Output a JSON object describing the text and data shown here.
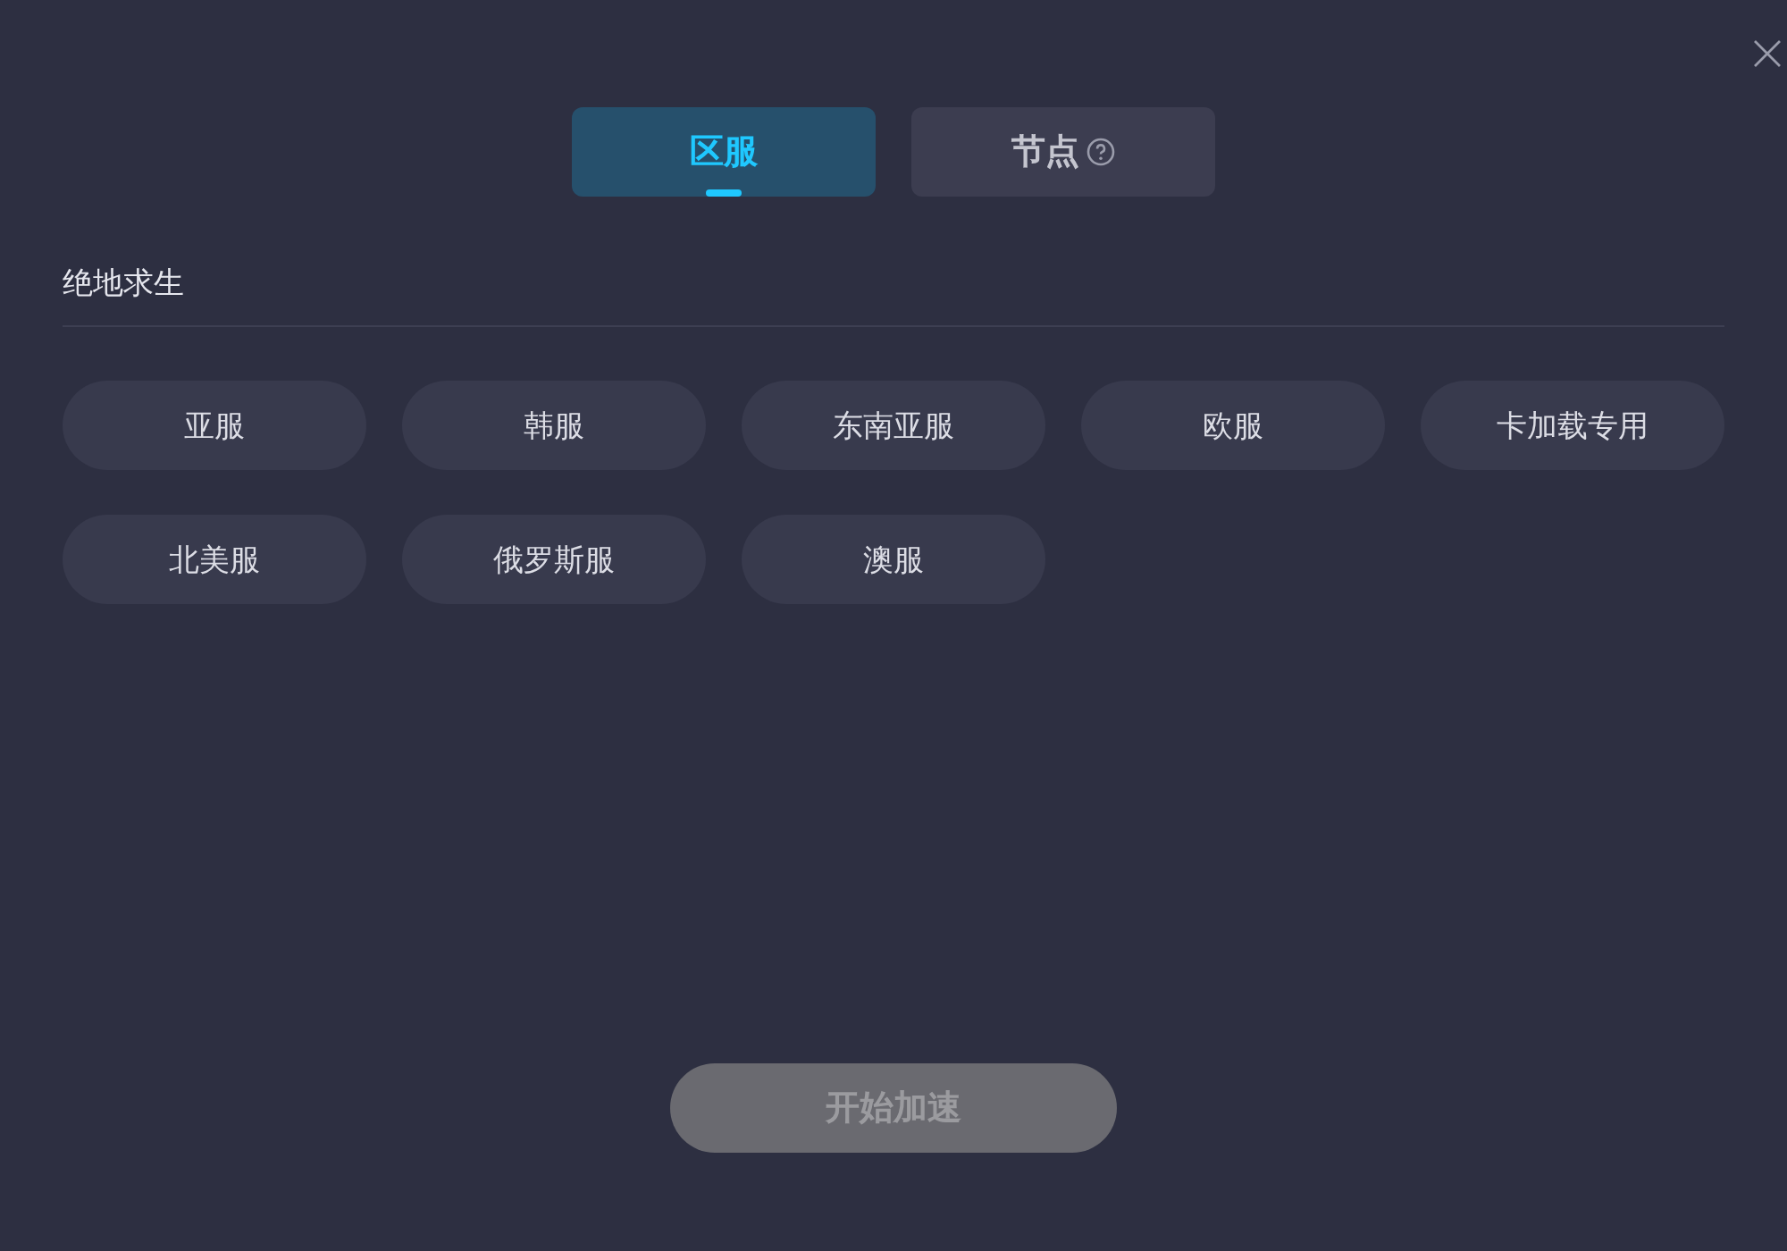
{
  "tabs": [
    {
      "label": "区服",
      "selected": true,
      "help": false
    },
    {
      "label": "节点",
      "selected": false,
      "help": true
    }
  ],
  "game": {
    "title": "绝地求生"
  },
  "regions": [
    {
      "label": "亚服",
      "selected": false
    },
    {
      "label": "韩服",
      "selected": false
    },
    {
      "label": "东南亚服",
      "selected": false
    },
    {
      "label": "欧服",
      "selected": false
    },
    {
      "label": "卡加载专用",
      "selected": false
    },
    {
      "label": "北美服",
      "selected": false
    },
    {
      "label": "俄罗斯服",
      "selected": false
    },
    {
      "label": "澳服",
      "selected": false
    }
  ],
  "start_button": {
    "label": "开始加速",
    "disabled": true
  }
}
